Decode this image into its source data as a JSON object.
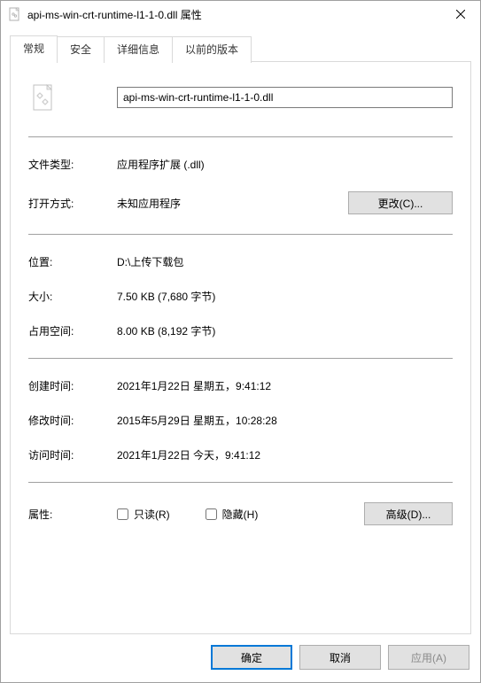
{
  "window": {
    "title": "api-ms-win-crt-runtime-l1-1-0.dll 属性"
  },
  "tabs": {
    "general": "常规",
    "security": "安全",
    "details": "详细信息",
    "previous": "以前的版本"
  },
  "file": {
    "name": "api-ms-win-crt-runtime-l1-1-0.dll"
  },
  "labels": {
    "filetype": "文件类型:",
    "openwith": "打开方式:",
    "location": "位置:",
    "size": "大小:",
    "sizeondisk": "占用空间:",
    "created": "创建时间:",
    "modified": "修改时间:",
    "accessed": "访问时间:",
    "attributes": "属性:"
  },
  "values": {
    "filetype": "应用程序扩展 (.dll)",
    "openwith": "未知应用程序",
    "location": "D:\\上传下载包",
    "size": "7.50 KB (7,680 字节)",
    "sizeondisk": "8.00 KB (8,192 字节)",
    "created": "2021年1月22日 星期五，9:41:12",
    "modified": "2015年5月29日 星期五，10:28:28",
    "accessed": "2021年1月22日 今天，9:41:12"
  },
  "buttons": {
    "change": "更改(C)...",
    "advanced": "高级(D)...",
    "ok": "确定",
    "cancel": "取消",
    "apply": "应用(A)"
  },
  "checkboxes": {
    "readonly": "只读(R)",
    "hidden": "隐藏(H)"
  }
}
